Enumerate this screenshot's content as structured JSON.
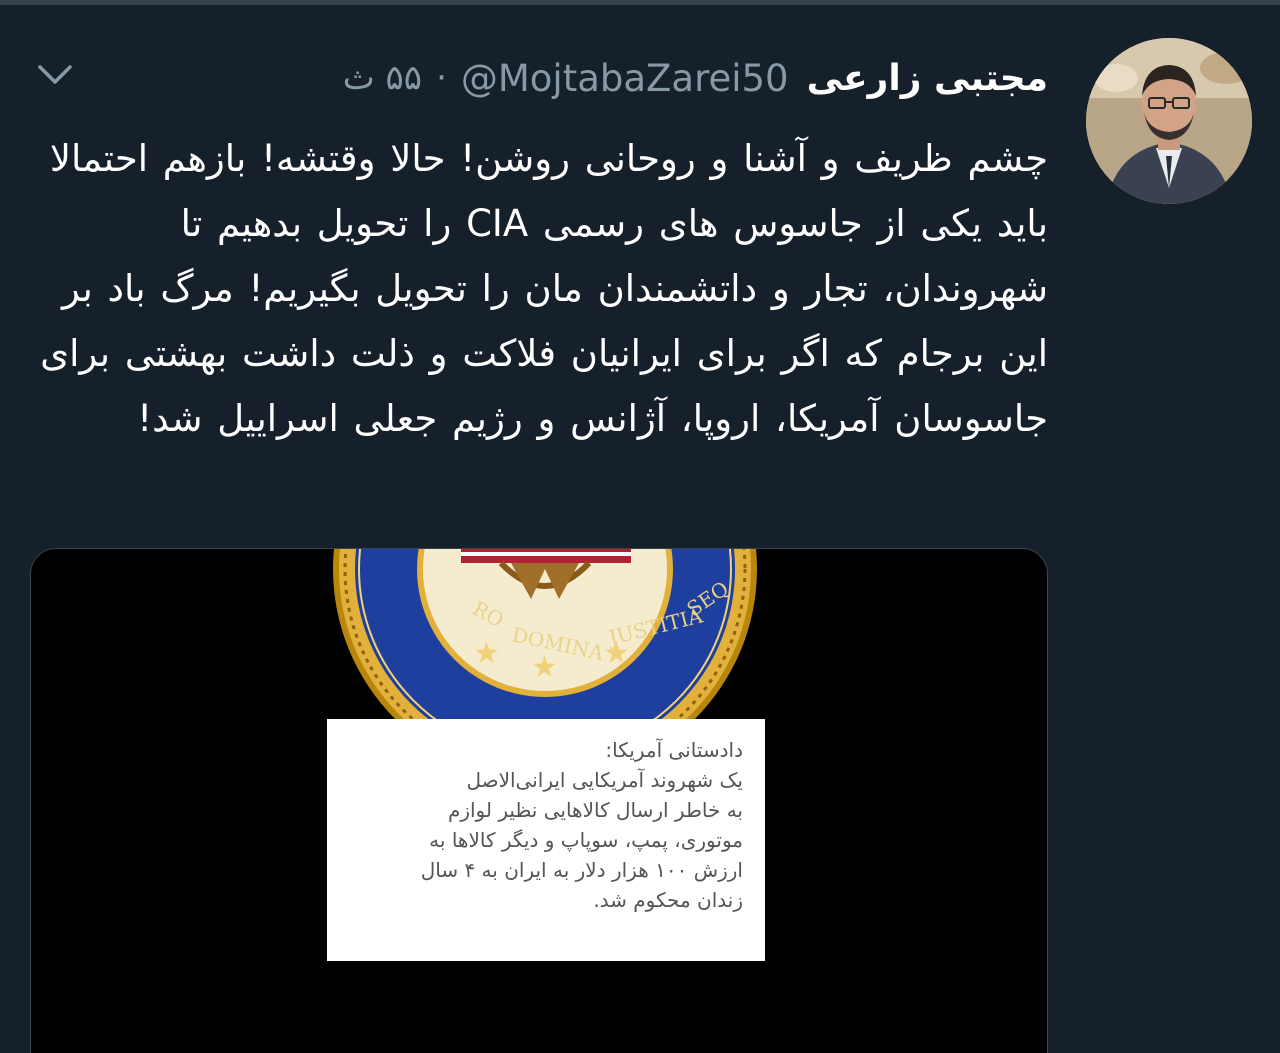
{
  "tweet": {
    "display_name": "مجتبی زارعی",
    "handle": "@MojtabaZarei50",
    "separator": "·",
    "time": "۵۵ ث",
    "text": "چشم ظریف و آشنا و روحانی روشن! حالا وقتشه! بازهم احتمالا باید یکی از جاسوس های رسمی CIA را تحویل بدهیم تا شهروندان، تجار و داتشمندان مان را تحویل بگیریم! مرگ باد بر این برجام که اگر برای ایرانیان فلاکت و ذلت داشت بهشتی برای جاسوسان آمریکا، اروپا، آژانس و رژیم جعلی اسراییل شد!"
  },
  "media": {
    "seal_motto": "PRO DOMINA JUSTITIA SEQ",
    "caption_title": "دادستانی آمریکا:",
    "caption_lines": [
      "یک شهروند آمریکایی ایرانی‌الاصل",
      "به خاطر ارسال کالاهایی نظیر لوازم",
      "موتوری، پمپ، سوپاپ و دیگر کالاها به",
      "ارزش ۱۰۰ هزار دلار به ایران به ۴ سال",
      "زندان محکوم شد."
    ]
  },
  "icons": {
    "menu": "chevron-down-icon",
    "avatar": "avatar"
  },
  "colors": {
    "background": "#15202b",
    "secondary_text": "#8899a6",
    "seal_gold": "#d4a017",
    "seal_blue": "#1f3f9e"
  }
}
